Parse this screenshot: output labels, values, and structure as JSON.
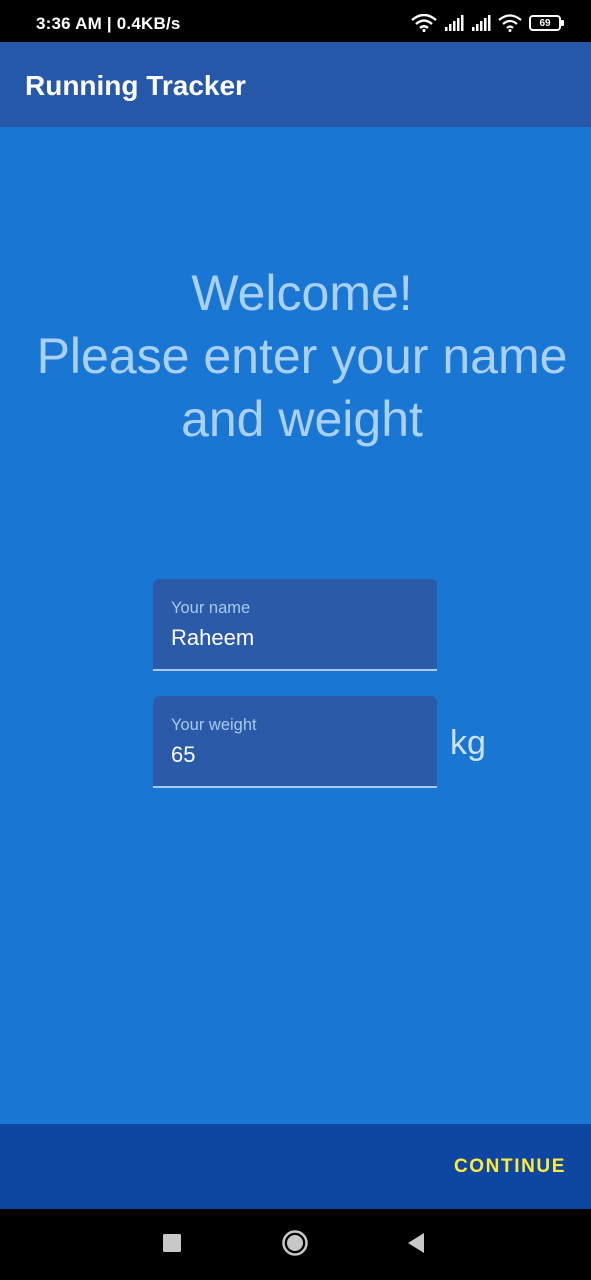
{
  "status_bar": {
    "time": "3:36 AM | 0.4KB/s",
    "battery": "69",
    "icons": [
      "wifi-icon",
      "cell-signal-icon",
      "cell-signal-icon",
      "wifi-icon",
      "battery-icon"
    ]
  },
  "app_bar": {
    "title": "Running Tracker"
  },
  "welcome": {
    "line1": "Welcome!",
    "line2": "Please enter your name",
    "line3": "and weight"
  },
  "form": {
    "name": {
      "label": "Your name",
      "value": "Raheem"
    },
    "weight": {
      "label": "Your weight",
      "value": "65",
      "unit": "kg"
    }
  },
  "actions": {
    "continue_label": "CONTINUE"
  },
  "nav_bar": {
    "icons": [
      "recents-icon",
      "home-icon",
      "back-icon"
    ]
  },
  "colors": {
    "status_bar": "#000000",
    "app_bar": "#2558a8",
    "background": "#1976d2",
    "field_background": "#2b5aa8",
    "bottom_bar": "#0d47a1",
    "accent": "#ffeb3b",
    "welcome_text": "#a9d0f7"
  }
}
